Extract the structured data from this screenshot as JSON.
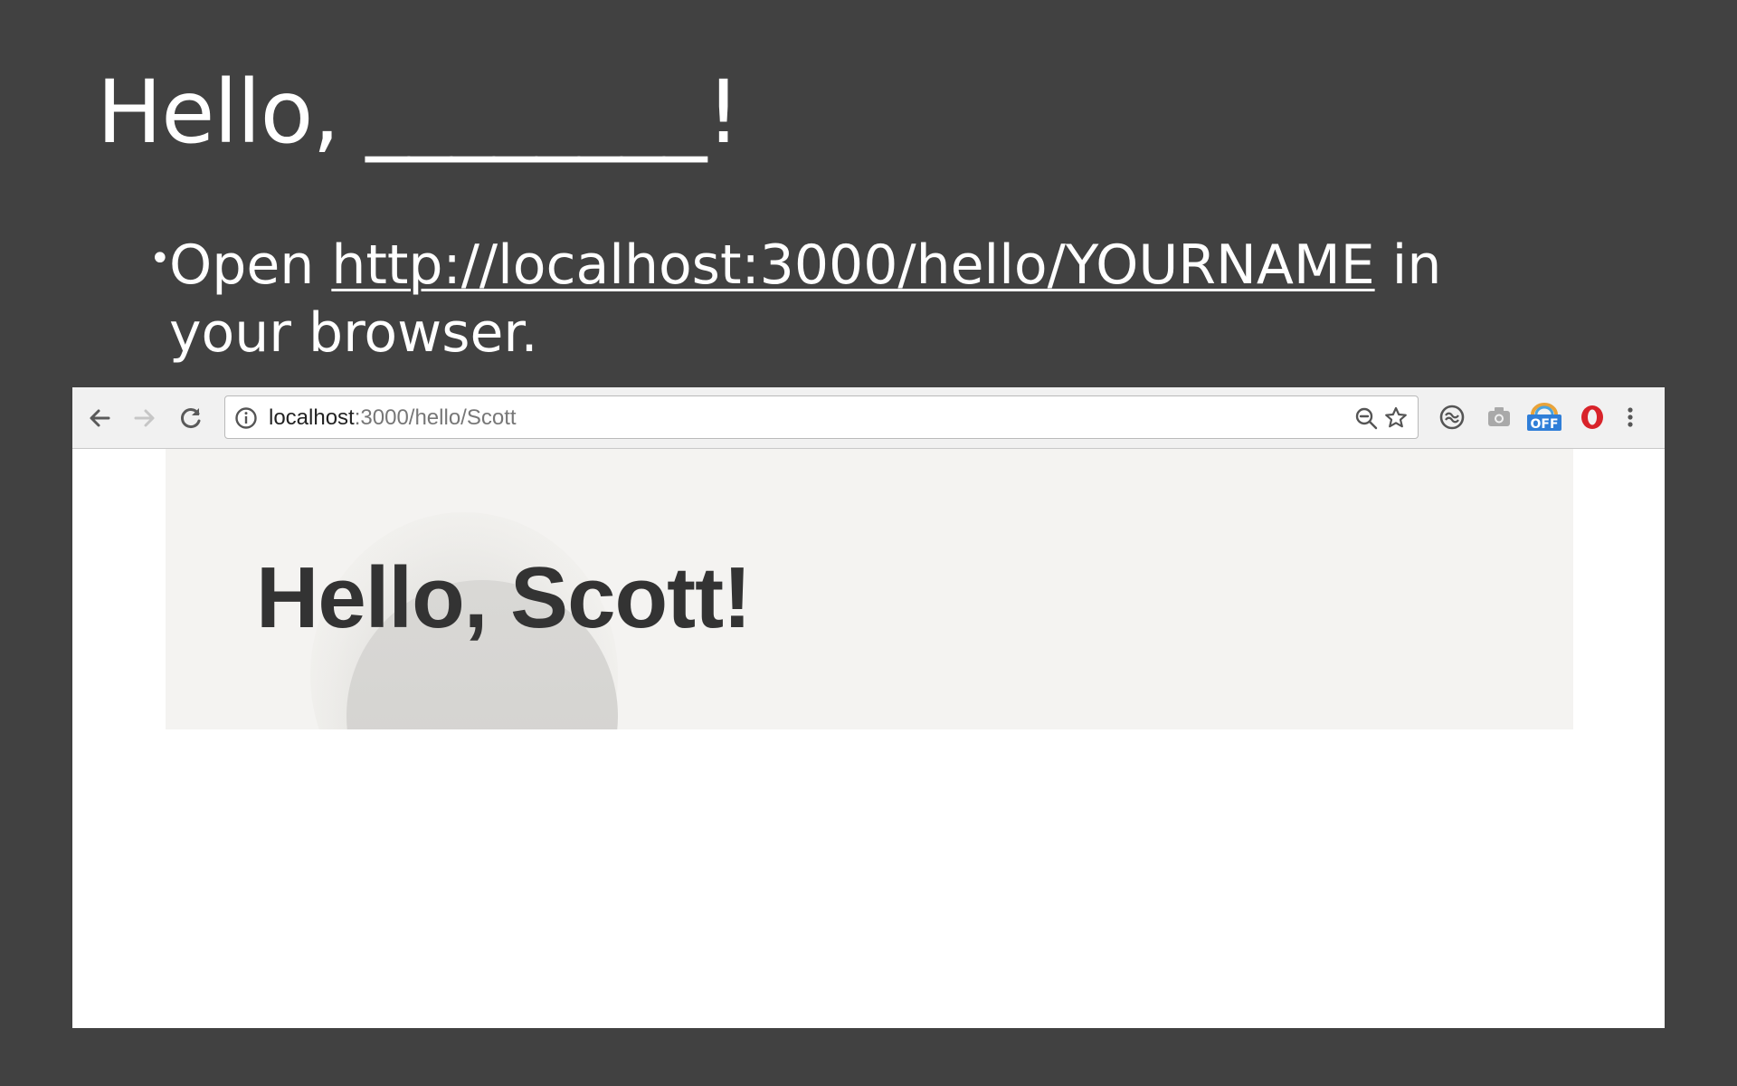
{
  "slide": {
    "title": "Hello, ________!",
    "bullet": {
      "prefix": "Open ",
      "link": "http://localhost:3000/hello/YOURNAME",
      "suffix": " in your browser."
    }
  },
  "browser": {
    "url_host": "localhost",
    "url_path": ":3000/hello/Scott",
    "icons": [
      "back-arrow-icon",
      "forward-arrow-icon",
      "reload-icon",
      "info-icon",
      "zoom-out-icon",
      "star-icon",
      "sync-extension-icon",
      "camera-extension-icon",
      "off-badge-extension-icon",
      "opera-extension-icon",
      "menu-dots-icon"
    ],
    "extension_badge": "OFF",
    "page": {
      "heading": "Hello, Scott!"
    }
  },
  "colors": {
    "slide_background": "#414141",
    "toolbar": "#f1f1f1",
    "jumbotron": "#f4f3f1",
    "heading_text": "#333333"
  }
}
